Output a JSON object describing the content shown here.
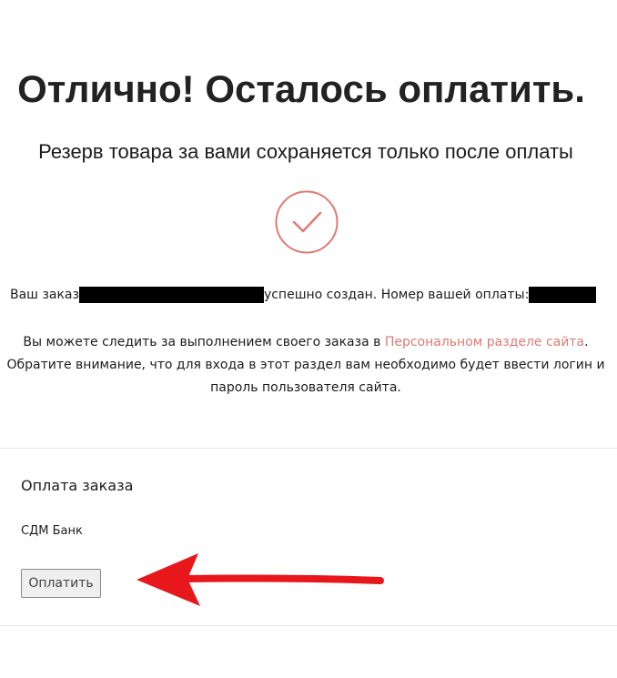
{
  "header": {
    "title": "Отлично! Осталось оплатить.",
    "subtitle": "Резерв товара за вами сохраняется только после оплаты"
  },
  "status_icon": "check-circle-icon",
  "order": {
    "prefix": "Ваш заказ",
    "middle": "успешно создан. Номер вашей оплаты:"
  },
  "info": {
    "text_before_link": "Вы можете следить за выполнением своего заказа в ",
    "link_text": "Персональном разделе сайта",
    "text_after_link": ". Обратите внимание, что для входа в этот раздел вам необходимо будет ввести логин и пароль пользователя сайта."
  },
  "payment": {
    "section_title": "Оплата заказа",
    "bank_name": "СДМ Банк",
    "pay_button_label": "Оплатить"
  },
  "annotation": {
    "arrow_icon": "red-arrow-left-icon"
  },
  "colors": {
    "accent": "#e07a72",
    "arrow_red": "#e8171c",
    "divider": "#e8e8e8"
  }
}
